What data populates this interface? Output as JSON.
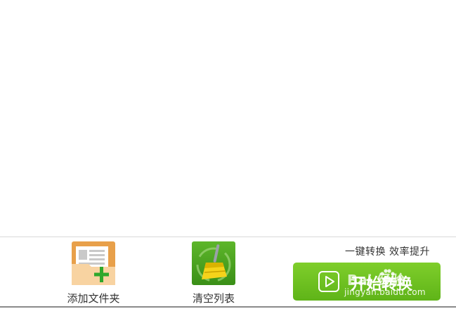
{
  "toolbar": {
    "add_folder_label": "添加文件夹",
    "clear_list_label": "清空列表"
  },
  "convert": {
    "slogan": "一键转换  效率提升",
    "start_label": "开始转换"
  },
  "watermark": {
    "brand": "Bai  经验",
    "url": "jingyan.baidu.com"
  },
  "colors": {
    "accent_green": "#6cc11f",
    "folder_orange": "#e8a04a",
    "broom_green": "#3f9a1c"
  }
}
